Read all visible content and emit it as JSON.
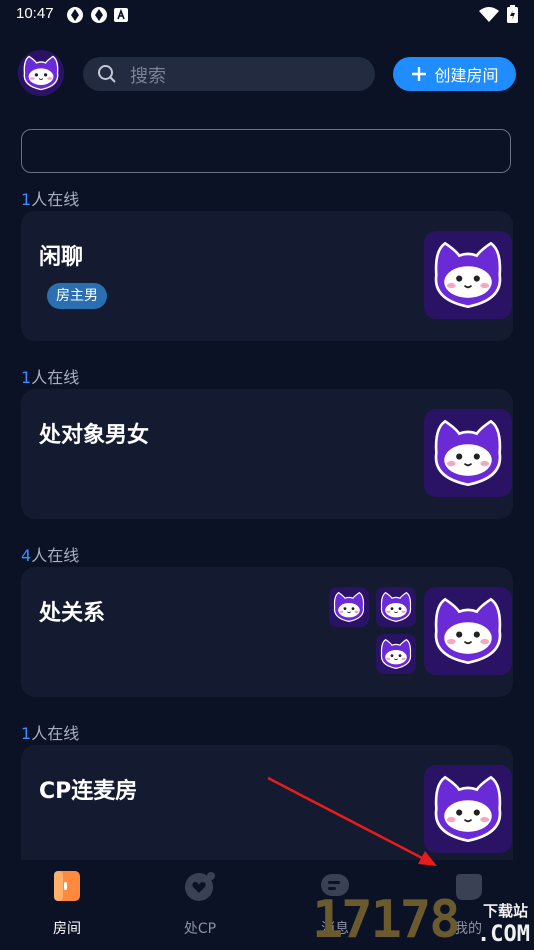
{
  "status": {
    "time": "10:47"
  },
  "header": {
    "search_placeholder": "搜索",
    "create_button_label": "创建房间"
  },
  "rooms": [
    {
      "online_count": "1",
      "online_suffix": "人在线",
      "title": "闲聊",
      "tag": "房主男"
    },
    {
      "online_count": "1",
      "online_suffix": "人在线",
      "title": "处对象男女"
    },
    {
      "online_count": "4",
      "online_suffix": "人在线",
      "title": "处关系"
    },
    {
      "online_count": "1",
      "online_suffix": "人在线",
      "title": "CP连麦房"
    }
  ],
  "tabs": [
    {
      "label": "房间",
      "active": true
    },
    {
      "label": "处CP",
      "active": false
    },
    {
      "label": "消息",
      "active": false
    },
    {
      "label": "我的",
      "active": false
    }
  ],
  "watermark": {
    "digits": "17178",
    "site": "下载站",
    "domain": ".COM"
  },
  "colors": {
    "accent": "#1f8cff",
    "background": "#0b1226",
    "card": "#141b31",
    "avatar_purple": "#6a2ad6"
  }
}
